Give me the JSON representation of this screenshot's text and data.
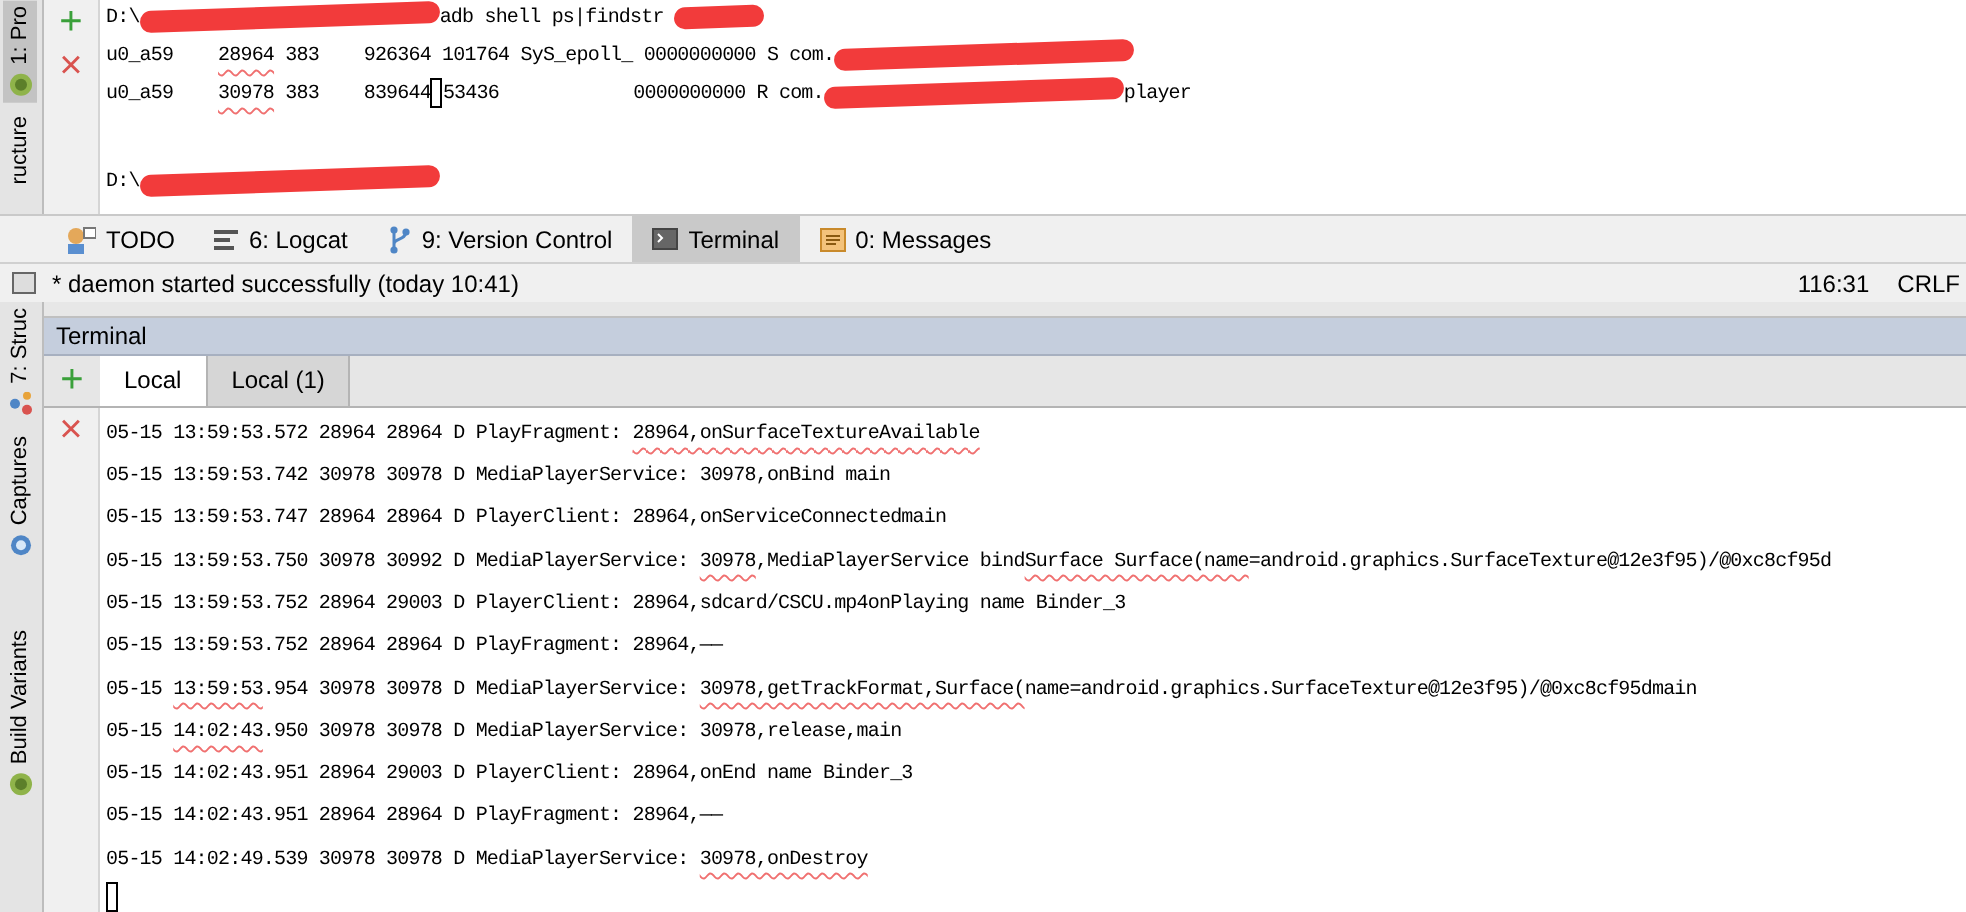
{
  "left_strip_top": [
    {
      "label": "1: Pro",
      "selected": true
    },
    {
      "label": "ructure",
      "selected": false
    }
  ],
  "console_buttons": [
    "+",
    "×"
  ],
  "top_console": {
    "lines": [
      {
        "segments": [
          {
            "kind": "text",
            "text": "D:\\",
            "underlined": false
          },
          {
            "kind": "redacted"
          },
          {
            "kind": "text",
            "text": "adb shell ps|findstr ",
            "underlined": false
          },
          {
            "kind": "redacted"
          }
        ]
      },
      {
        "segments": [
          {
            "kind": "text",
            "text": "u0_a59    ",
            "underlined": false
          },
          {
            "kind": "text",
            "text": "28964",
            "underlined": true
          },
          {
            "kind": "text",
            "text": " 383    926364 101764 SyS_epoll_ 0000000000 S com.",
            "underlined": false
          },
          {
            "kind": "redacted"
          }
        ]
      },
      {
        "segments": [
          {
            "kind": "text",
            "text": "u0_a59    ",
            "underlined": false
          },
          {
            "kind": "text",
            "text": "30978",
            "underlined": true
          },
          {
            "kind": "text",
            "text": " 383    839644",
            "underlined": false
          },
          {
            "kind": "cursor"
          },
          {
            "kind": "text",
            "text": "53436            0000000000 R com.",
            "underlined": false
          },
          {
            "kind": "redacted"
          },
          {
            "kind": "text",
            "text": "player",
            "underlined": false
          }
        ]
      }
    ],
    "prompt": {
      "segments": [
        {
          "kind": "text",
          "text": "D:\\",
          "underlined": false
        },
        {
          "kind": "redacted"
        }
      ]
    }
  },
  "tool_tabs": [
    {
      "label": "TODO",
      "selected": false
    },
    {
      "label": "6: Logcat",
      "selected": false
    },
    {
      "label": "9: Version Control",
      "selected": false
    },
    {
      "label": "Terminal",
      "selected": true
    },
    {
      "label": "0: Messages",
      "selected": false
    }
  ],
  "status_bar": {
    "message": "* daemon started successfully (today 10:41)",
    "position": "116:31",
    "line_separator": "CRLF"
  },
  "left_strip_bottom": [
    {
      "label": "7: Struc"
    },
    {
      "label": "Captures"
    },
    {
      "label": "Build Variants"
    }
  ],
  "terminal": {
    "title": "Terminal",
    "new_tab_button": "+",
    "close_button": "×",
    "tabs": [
      {
        "label": "Local",
        "selected": true
      },
      {
        "label": "Local (1)",
        "selected": false
      }
    ],
    "lines": [
      {
        "segments": [
          {
            "text": "05-15 13:59:53.572 28964 28964 D PlayFragment: ",
            "underlined": false
          },
          {
            "text": "28964,onSurfaceTextureAvailable",
            "underlined": true
          }
        ]
      },
      {
        "segments": [
          {
            "text": "05-15 13:59:53.742 30978 30978 D MediaPlayerService: 30978,onBind main",
            "underlined": false
          }
        ]
      },
      {
        "segments": [
          {
            "text": "05-15 13:59:53.747 28964 28964 D PlayerClient: 28964,onServiceConnectedmain",
            "underlined": false
          }
        ]
      },
      {
        "segments": [
          {
            "text": "05-15 13:59:53.750 30978 30992 D MediaPlayerService: ",
            "underlined": false
          },
          {
            "text": "30978",
            "underlined": true
          },
          {
            "text": ",MediaPlayerService bind",
            "underlined": false
          },
          {
            "text": "Surface Surface(name",
            "underlined": true
          },
          {
            "text": "=android.graphics.SurfaceTexture@12e3f95)/@0xc8cf95d",
            "underlined": false
          }
        ]
      },
      {
        "segments": [
          {
            "text": "05-15 13:59:53.752 28964 29003 D PlayerClient: 28964,sdcard/CSCU.mp4onPlaying name Binder_3",
            "underlined": false
          }
        ]
      },
      {
        "segments": [
          {
            "text": "05-15 13:59:53.752 28964 28964 D PlayFragment: 28964,——",
            "underlined": false
          }
        ]
      },
      {
        "segments": [
          {
            "text": "05-15 ",
            "underlined": false
          },
          {
            "text": "13:59:53",
            "underlined": true
          },
          {
            "text": ".954 30978 30978 D MediaPlayerService: ",
            "underlined": false
          },
          {
            "text": "30978,getTrackFormat,Surface(",
            "underlined": true
          },
          {
            "text": "name=android.graphics.SurfaceTexture@12e3f95)/@0xc8cf95dmain",
            "underlined": false
          }
        ]
      },
      {
        "segments": [
          {
            "text": "05-15 ",
            "underlined": false
          },
          {
            "text": "14:02:43",
            "underlined": true
          },
          {
            "text": ".950 30978 30978 D MediaPlayerService: 30978,release,main",
            "underlined": false
          }
        ]
      },
      {
        "segments": [
          {
            "text": "05-15 14:02:43.951 28964 29003 D PlayerClient: 28964,onEnd name Binder_3",
            "underlined": false
          }
        ]
      },
      {
        "segments": [
          {
            "text": "05-15 14:02:43.951 28964 28964 D PlayFragment: 28964,——",
            "underlined": false
          }
        ]
      },
      {
        "segments": [
          {
            "text": "05-15 14:02:49.539 30978 30978 D MediaPlayerService: ",
            "underlined": false
          },
          {
            "text": "30978,onDestroy",
            "underlined": true
          }
        ]
      }
    ],
    "cursor": true
  }
}
